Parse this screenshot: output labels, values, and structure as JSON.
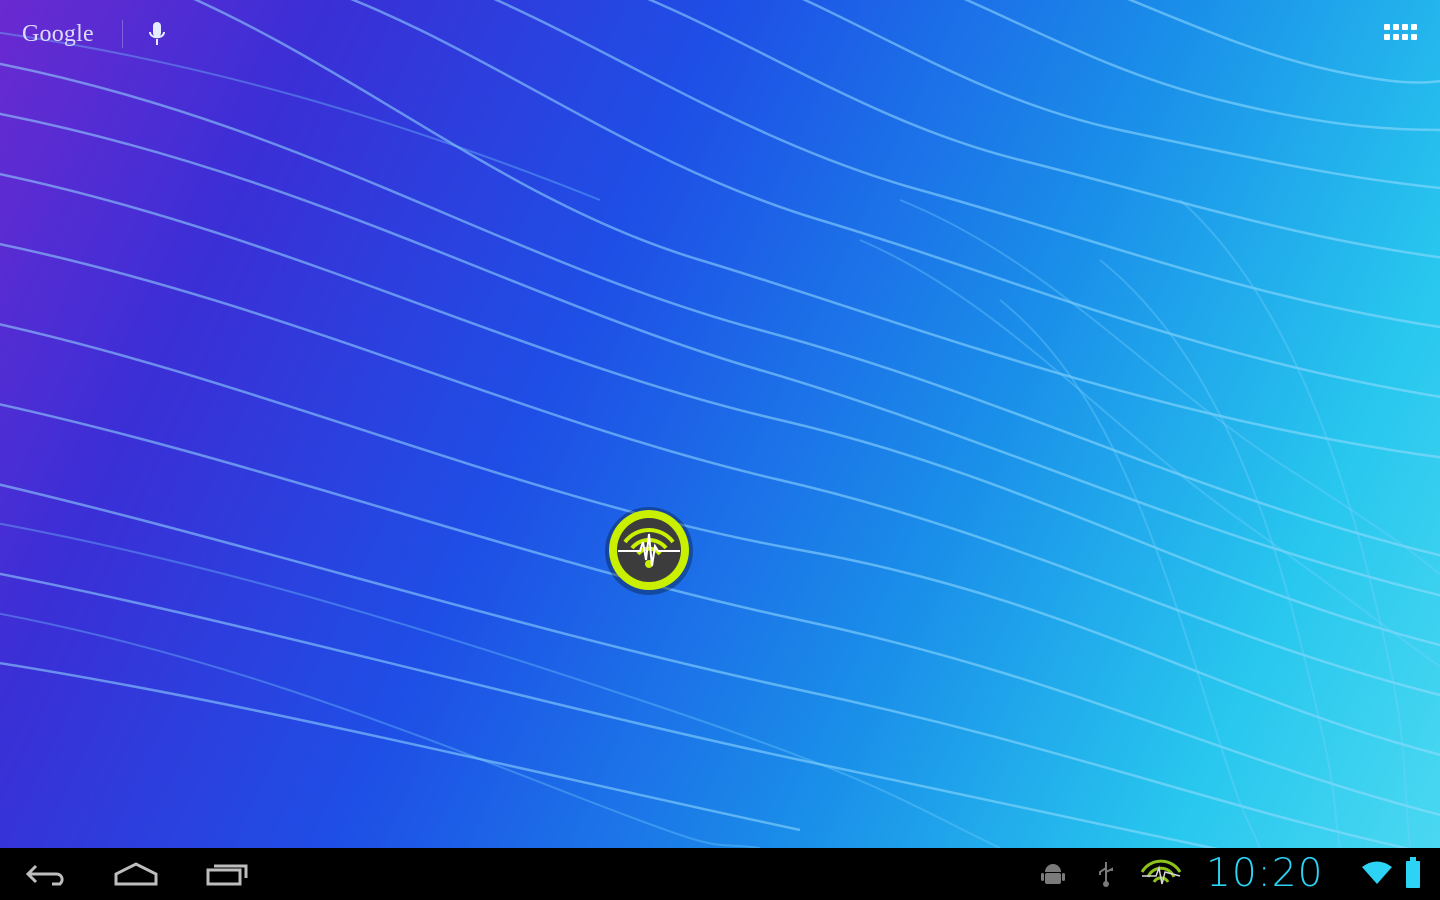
{
  "home_screen": {
    "search_widget": {
      "logo_text": "Google",
      "mic_icon": "microphone-icon"
    },
    "apps_button_icon": "all-apps-grid-icon",
    "app_shortcut_icon": "wifi-analyzer-app-icon"
  },
  "navigation_bar": {
    "back_icon": "back-arrow-icon",
    "home_icon": "home-icon",
    "recents_icon": "recent-apps-icon"
  },
  "status_bar": {
    "time": "10:20",
    "icons": [
      "android-debug-icon",
      "usb-icon",
      "wifi-analyzer-notification-icon",
      "wifi-signal-icon",
      "battery-icon"
    ],
    "accent_color": "#2dd3f5"
  },
  "colors": {
    "app_ring": "#c8f000",
    "wallpaper_left": "#6a2ad0",
    "wallpaper_right": "#4ad8f1"
  }
}
